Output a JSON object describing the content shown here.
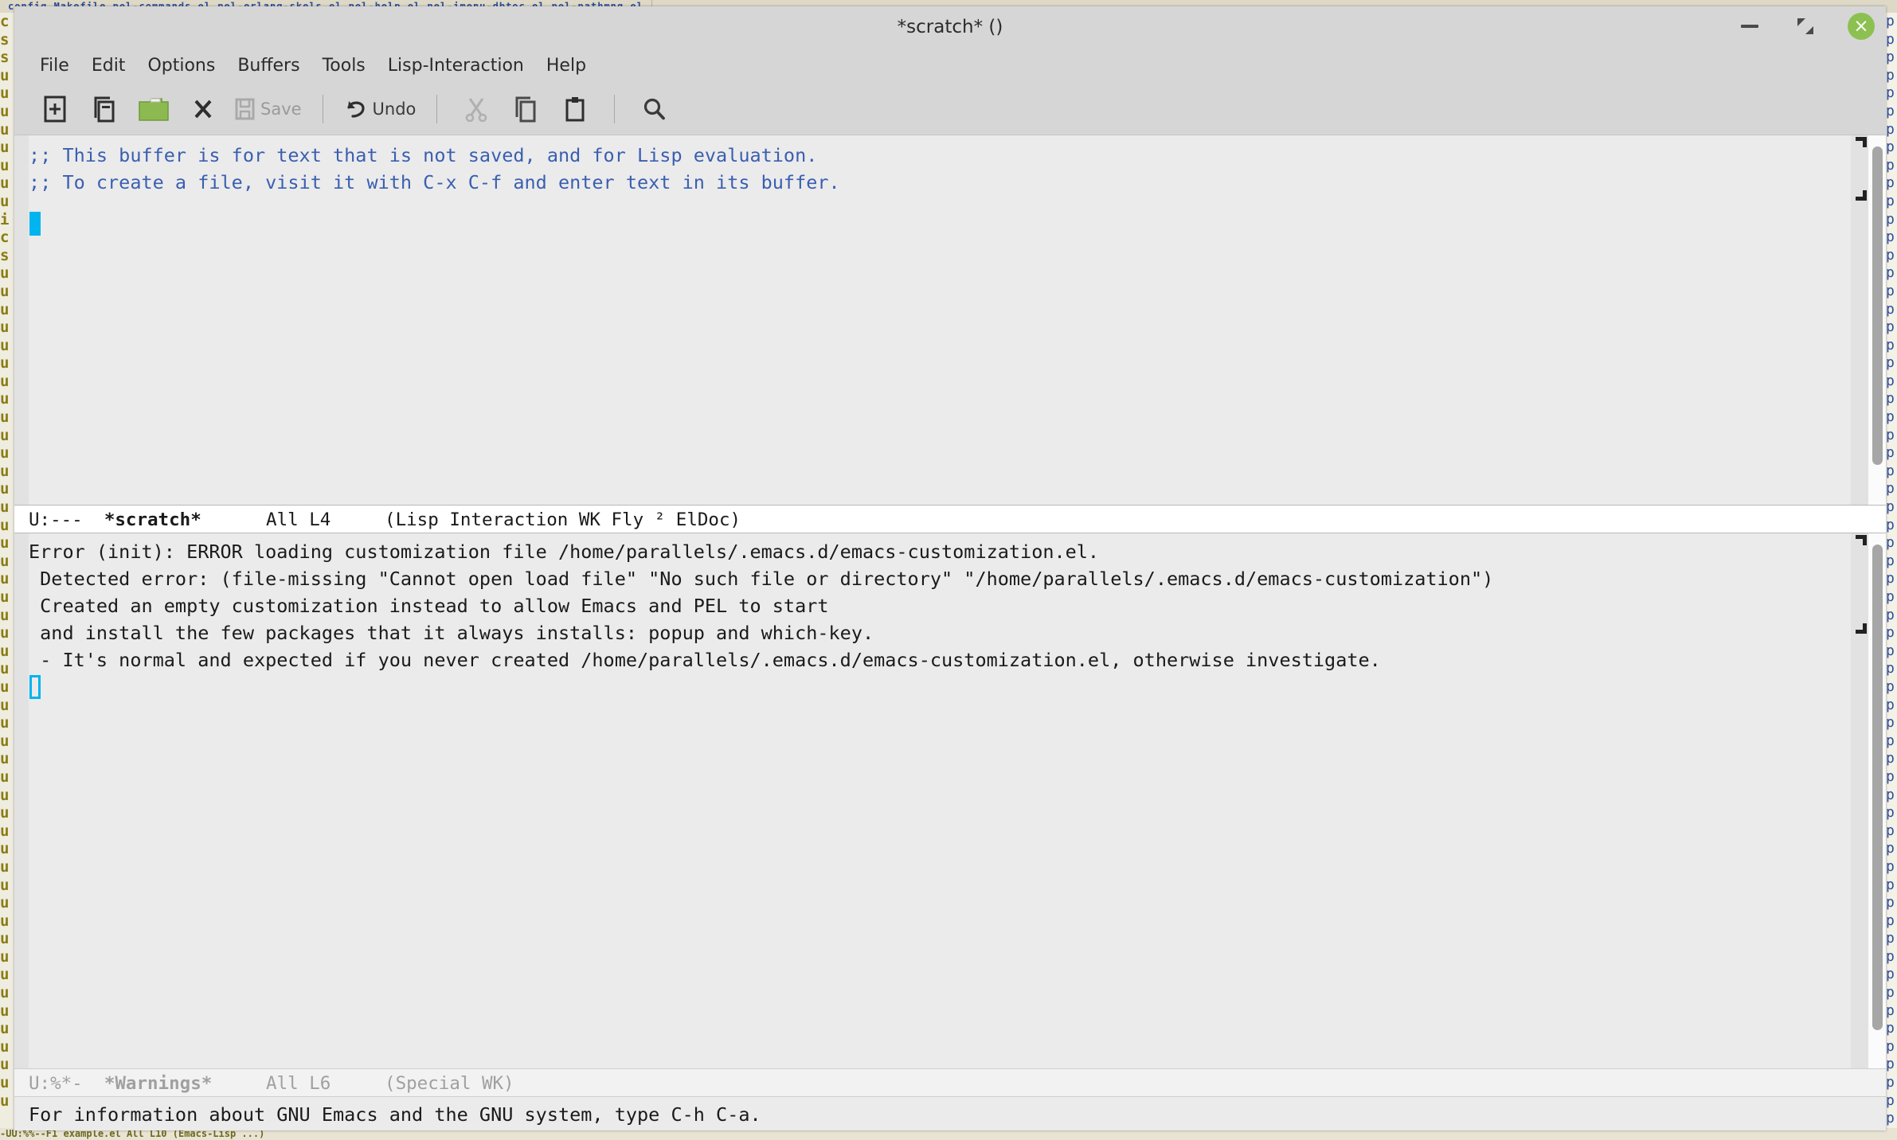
{
  "window": {
    "title": "*scratch* ()",
    "controls": {
      "minimize": "minimize",
      "maximize": "restore",
      "close": "×"
    }
  },
  "menubar": {
    "items": [
      {
        "label": "File"
      },
      {
        "label": "Edit"
      },
      {
        "label": "Options"
      },
      {
        "label": "Buffers"
      },
      {
        "label": "Tools"
      },
      {
        "label": "Lisp-Interaction"
      },
      {
        "label": "Help"
      }
    ]
  },
  "toolbar": {
    "new_file_icon": "new-file-icon",
    "open_file_icon": "open-file-icon",
    "dired_icon": "open-folder-icon",
    "close_buffer_icon": "close-buffer-icon",
    "save_label": "Save",
    "save_icon": "save-disk-icon",
    "undo_label": "Undo",
    "undo_icon": "undo-arrow-icon",
    "cut_icon": "scissors-icon",
    "copy_icon": "copy-icon",
    "paste_icon": "clipboard-paste-icon",
    "search_icon": "magnifier-icon"
  },
  "scratch_window": {
    "lines": [
      ";; This buffer is for text that is not saved, and for Lisp evaluation.",
      ";; To create a file, visit it with C-x C-f and enter text in its buffer."
    ],
    "modeline": {
      "status": "U:---",
      "buffer": "*scratch*",
      "position": "All L4",
      "modes": "(Lisp Interaction WK Fly ² ElDoc)"
    }
  },
  "warnings_window": {
    "lines": [
      "Error (init): ERROR loading customization file /home/parallels/.emacs.d/emacs-customization.el.",
      " Detected error: (file-missing \"Cannot open load file\" \"No such file or directory\" \"/home/parallels/.emacs.d/emacs-customization\")",
      " Created an empty customization instead to allow Emacs and PEL to start",
      " and install the few packages that it always installs: popup and which-key.",
      " - It's normal and expected if you never created /home/parallels/.emacs.d/emacs-customization.el, otherwise investigate."
    ],
    "modeline": {
      "status": "U:%*-",
      "buffer": "*Warnings*",
      "position": "All L6",
      "modes": "(Special WK)"
    }
  },
  "echo_area": {
    "message": "For information about GNU Emacs and the GNU system, type C-h C-a."
  },
  "background": {
    "menu_text": "config    Makefile       pel-commands.el      pel-erlang-skels.el      pel-help.el      pel-imenu-dbtoc.el      pel-pathmng.el",
    "left_column": "c\ns\ns\nu\nu\nu\nu\nu\nu\nu\nu\ni\nc\ns\nu\nu\nu\nu\nu\nu\nu\nu\nu\nu\nu\nu\nu\nu\nu\nu\nu\nu\nu\nu\nu\nu\nu\nu\nu\nu\nu\nu\nu\nu\nu\nu\nu\nu\nu\nu\nu\nu\nu\nu\nu\nu\nu\nu\nu\nu\nu",
    "right_column": "p\np\np\np\np\np\np\np\np\np\np\np\np\np\np\np\np\np\np\np\np\np\np\np\np\np\np\np\np\np\np\np\np\np\np\np\np\np\np\np\np\np\np\np\np\np\np\np\np\np\np\np\np\np\np\np\np\np\np\np\np\np",
    "bottom_text": "-UU:%%--F1  example.el  All L10    (Emacs-Lisp ...)"
  },
  "colors": {
    "frame_bg": "#d6d6d6",
    "buffer_bg": "#ebebeb",
    "comment_fg": "#3a5fb0",
    "cursor": "#00b4f0",
    "modeline_active_bg": "#ffffff",
    "modeline_inactive_fg": "#a0a0a0",
    "close_button_bg": "#8cc152",
    "folder_icon": "#8cba51"
  }
}
